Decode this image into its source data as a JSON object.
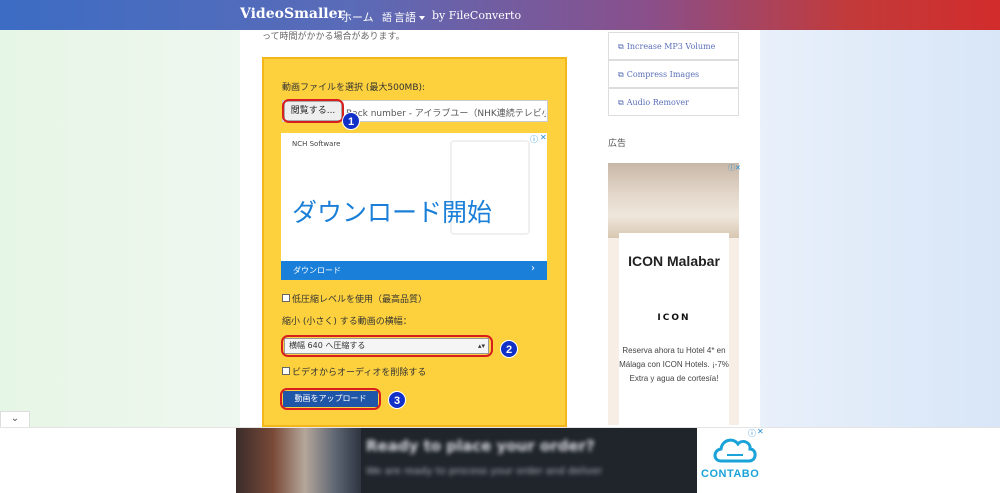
{
  "navbar": {
    "brand": "VideoSmaller",
    "items": [
      {
        "label": "ホーム"
      },
      {
        "label": "言語"
      },
      {
        "label": "by FileConverto"
      }
    ]
  },
  "main": {
    "intro_text": "って時間がかかる場合があります。",
    "form": {
      "file_label": "動画ファイルを選択 (最大500MB):",
      "browse_label": "閲覧する...",
      "file_name": "Back number - アイラブユー（NHK連続テレビ小説",
      "low_compression_label": "低圧縮レベルを使用（最高品質）",
      "width_label": "縮小 (小さく) する動画の横幅：",
      "width_select_value": "横幅 640 へ圧縮する",
      "remove_audio_label": "ビデオからオーディオを削除する",
      "upload_label": "動画をアップロード"
    },
    "markers": [
      "1",
      "2",
      "3"
    ],
    "inline_ad": {
      "sponsor": "NCH Software",
      "headline": "ダウンロード開始",
      "cta": "ダウンロード",
      "cta_chevron": "›",
      "info_icon": "ⓘ",
      "close_icon": "✕"
    }
  },
  "sidebar": {
    "links": [
      {
        "label": "Increase MP3 Volume",
        "icon": "external-link-icon"
      },
      {
        "label": "Compress Images",
        "icon": "external-link-icon"
      },
      {
        "label": "Audio Remover",
        "icon": "external-link-icon"
      }
    ],
    "ads_label": "広告",
    "ad": {
      "title": "ICON Malabar",
      "logo": "ICON",
      "body": "Reserva ahora tu Hotel 4* en Málaga con ICON Hotels. ¡-7% Extra y agua de cortesía!",
      "info_icon": "ⓘ✕"
    }
  },
  "bottom_ad": {
    "headline": "Ready to place your order?",
    "subtext": "We are ready to process your order and deliver",
    "brand": "CONTABO",
    "info_icon": "ⓘ",
    "close_icon": "✕",
    "collapse_icon": "⌄"
  },
  "colors": {
    "panel_yellow": "#fdd13d",
    "highlight_red": "#d81f1f",
    "marker_blue": "#1030c8",
    "ad_blue": "#1a7fd8",
    "upload_button": "#2056a8",
    "link_blue": "#5a6fb8"
  }
}
